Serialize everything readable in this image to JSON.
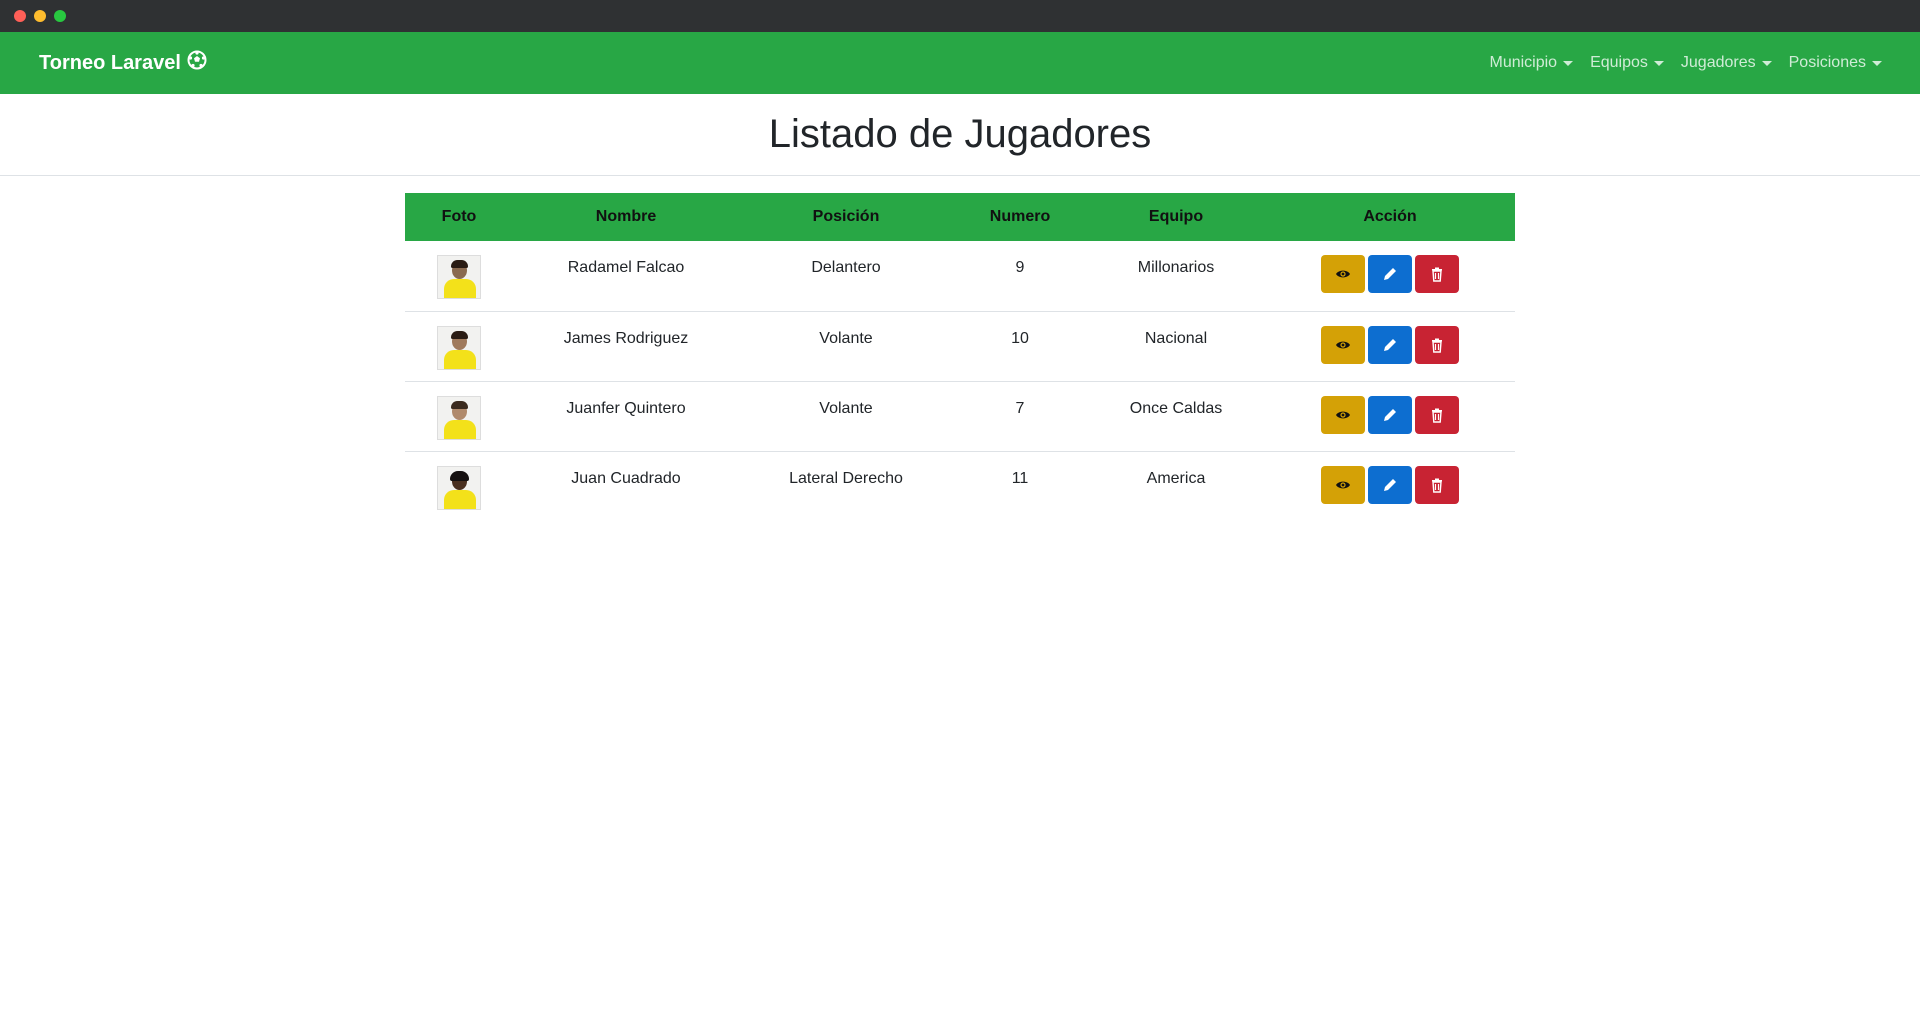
{
  "navbar": {
    "brand": "Torneo Laravel",
    "brand_icon": "soccer-ball-icon",
    "menu": [
      {
        "label": "Municipio"
      },
      {
        "label": "Equipos"
      },
      {
        "label": "Jugadores"
      },
      {
        "label": "Posiciones"
      }
    ]
  },
  "page": {
    "title": "Listado de Jugadores"
  },
  "table": {
    "headers": [
      "Foto",
      "Nombre",
      "Posición",
      "Numero",
      "Equipo",
      "Acción"
    ],
    "rows": [
      {
        "nombre": "Radamel Falcao",
        "posicion": "Delantero",
        "numero": "9",
        "equipo": "Millonarios"
      },
      {
        "nombre": "James Rodriguez",
        "posicion": "Volante",
        "numero": "10",
        "equipo": "Nacional"
      },
      {
        "nombre": "Juanfer Quintero",
        "posicion": "Volante",
        "numero": "7",
        "equipo": "Once Caldas"
      },
      {
        "nombre": "Juan Cuadrado",
        "posicion": "Lateral Derecho",
        "numero": "11",
        "equipo": "America"
      }
    ]
  },
  "colors": {
    "primary_green": "#28a745",
    "view_button": "#d4a106",
    "edit_button": "#0d6ed0",
    "delete_button": "#c82333"
  }
}
